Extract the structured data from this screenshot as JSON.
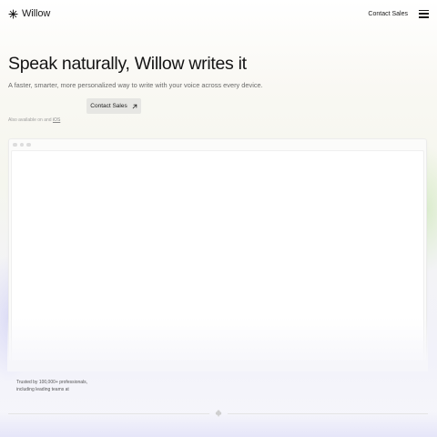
{
  "header": {
    "logo_text": "Willow",
    "contact_label": "Contact Sales",
    "menu_icon": "hamburger-menu-icon"
  },
  "hero": {
    "title": "Speak naturally, Willow writes it",
    "subtitle": "A faster, smarter, more personalized way to write with your voice across every device.",
    "cta_label": "Contact Sales",
    "cta_icon": "arrow-up-right-icon",
    "also_prefix": "Also available on",
    "also_and": "and",
    "also_link": "iOS"
  },
  "trust": {
    "line1": "Trusted by 100,000+ professionals,",
    "line2": "including leading teams at"
  },
  "colors": {
    "text": "#1a1a1a",
    "muted": "#6a6a6a",
    "button_bg": "#e6e6e3",
    "window_dot": "#dcdcdc"
  }
}
